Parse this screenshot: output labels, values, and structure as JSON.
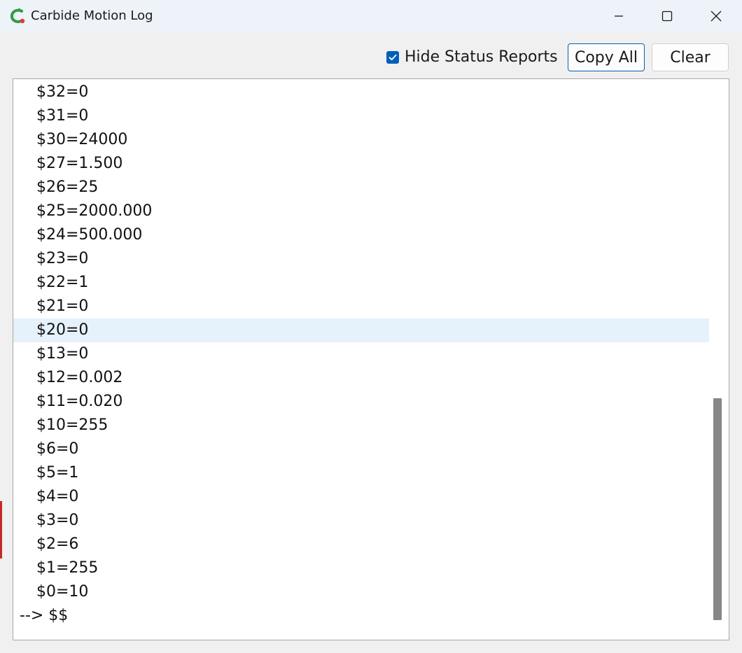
{
  "window": {
    "title": "Carbide Motion Log",
    "icon": "carbide-logo-icon",
    "controls": {
      "minimize": "minimize-icon",
      "maximize": "maximize-icon",
      "close": "close-icon"
    }
  },
  "toolbar": {
    "hide_status_label": "Hide Status Reports",
    "hide_status_checked": true,
    "copy_all_label": "Copy All",
    "clear_label": "Clear"
  },
  "log": {
    "lines": [
      "$32=0",
      "$31=0",
      "$30=24000",
      "$27=1.500",
      "$26=25",
      "$25=2000.000",
      "$24=500.000",
      "$23=0",
      "$22=1",
      "$21=0",
      "$20=0",
      "$13=0",
      "$12=0.002",
      "$11=0.020",
      "$10=255",
      "$6=0",
      "$5=1",
      "$4=0",
      "$3=0",
      "$2=6",
      "$1=255",
      "$0=10"
    ],
    "selected_index": 10,
    "prompt": "--> $$"
  },
  "colors": {
    "accent": "#005fb8",
    "selection": "#e5f1fb",
    "scroll_thumb": "#878787"
  }
}
